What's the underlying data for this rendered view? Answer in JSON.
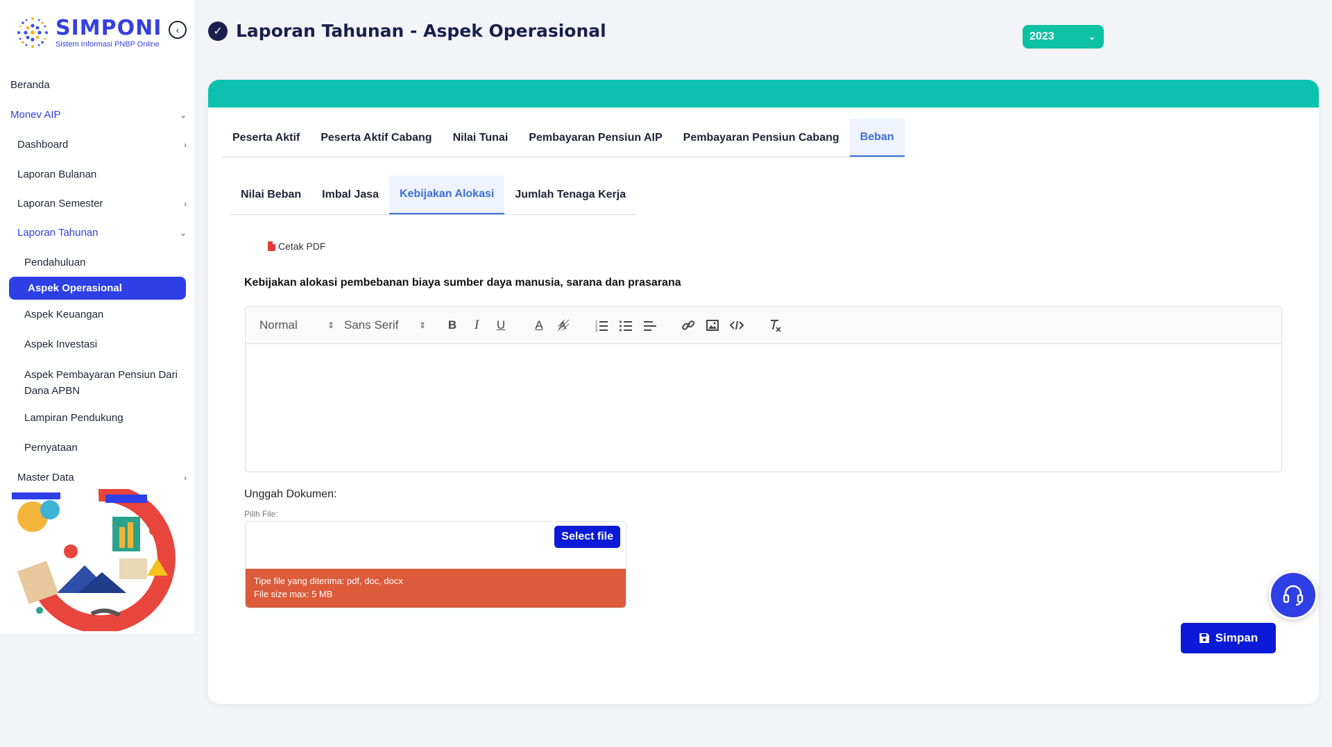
{
  "brand": {
    "title": "SIMPONI",
    "subtitle": "Sistem Informasi PNBP Online"
  },
  "sidebar": {
    "items": [
      {
        "label": "Beranda"
      },
      {
        "label": "Monev AIP"
      },
      {
        "label": "Dashboard"
      },
      {
        "label": "Laporan Bulanan"
      },
      {
        "label": "Laporan Semester"
      },
      {
        "label": "Laporan Tahunan"
      },
      {
        "label": "Pendahuluan"
      },
      {
        "label": "Aspek Operasional"
      },
      {
        "label": "Aspek Keuangan"
      },
      {
        "label": "Aspek Investasi"
      },
      {
        "label": "Aspek Pembayaran Pensiun Dari Dana APBN"
      },
      {
        "label": "Lampiran Pendukung"
      },
      {
        "label": "Pernyataan"
      },
      {
        "label": "Master Data"
      }
    ]
  },
  "header": {
    "title": "Laporan Tahunan - Aspek Operasional",
    "year": "2023"
  },
  "tabs": [
    {
      "label": "Peserta Aktif"
    },
    {
      "label": "Peserta Aktif Cabang"
    },
    {
      "label": "Nilai Tunai"
    },
    {
      "label": "Pembayaran Pensiun AIP"
    },
    {
      "label": "Pembayaran Pensiun Cabang"
    },
    {
      "label": "Beban"
    }
  ],
  "subtabs": [
    {
      "label": "Nilai Beban"
    },
    {
      "label": "Imbal Jasa"
    },
    {
      "label": "Kebijakan Alokasi"
    },
    {
      "label": "Jumlah Tenaga Kerja"
    }
  ],
  "content": {
    "print_label": "Cetak PDF",
    "section_title": "Kebijakan alokasi pembebanan biaya sumber daya manusia, sarana dan prasarana",
    "editor": {
      "format": "Normal",
      "font": "Sans Serif"
    },
    "upload_label": "Unggah Dokumen:",
    "file_label": "Pilih File:",
    "select_file": "Select file",
    "file_types": "Tipe file yang diterima: pdf, doc, docx",
    "file_size": "File size max: 5 MB",
    "save_label": "Simpan"
  },
  "colors": {
    "primary": "#2e3fe6",
    "teal": "#0cc1b0",
    "warning": "#db5b3a"
  }
}
